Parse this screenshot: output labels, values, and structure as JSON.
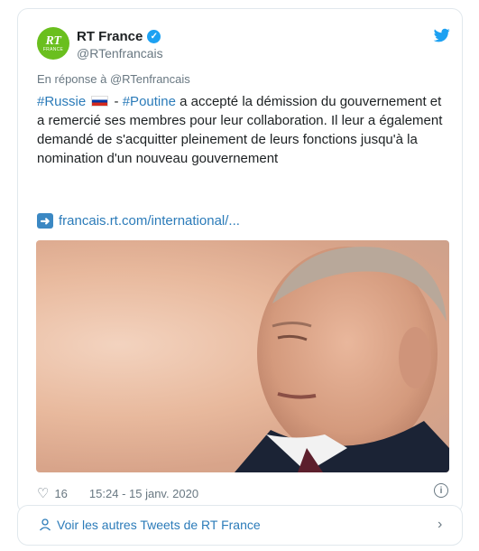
{
  "account": {
    "name": "RT France",
    "handle": "@RTenfrancais",
    "avatar_text": "RT",
    "avatar_subtext": "FRANCE"
  },
  "reply_to": "En réponse à @RTenfrancais",
  "tweet": {
    "hashtag1": "#Russie",
    "separator": " - ",
    "hashtag2": "#Poutine",
    "body": " a accepté la démission du gouvernement et a remercié ses membres pour leur collaboration. Il leur a également demandé de s'acquitter pleinement de leurs fonctions jusqu'à la nomination d'un nouveau gouvernement",
    "link": "francais.rt.com/international/..."
  },
  "meta": {
    "likes": "16",
    "timestamp": "15:24 - 15 janv. 2020"
  },
  "footer": {
    "label": "Voir les autres Tweets de RT France"
  },
  "icons": {
    "bird": "twitter-bird-icon",
    "verified": "verified-icon",
    "heart": "heart-icon",
    "info": "info-icon",
    "chevron": "chevron-right-icon",
    "person": "person-icon",
    "arrow": "right-arrow-icon",
    "flag": "russia-flag-icon"
  },
  "colors": {
    "accent": "#1da1f2",
    "link": "#2b7bb9",
    "avatar": "#6abf1e"
  }
}
